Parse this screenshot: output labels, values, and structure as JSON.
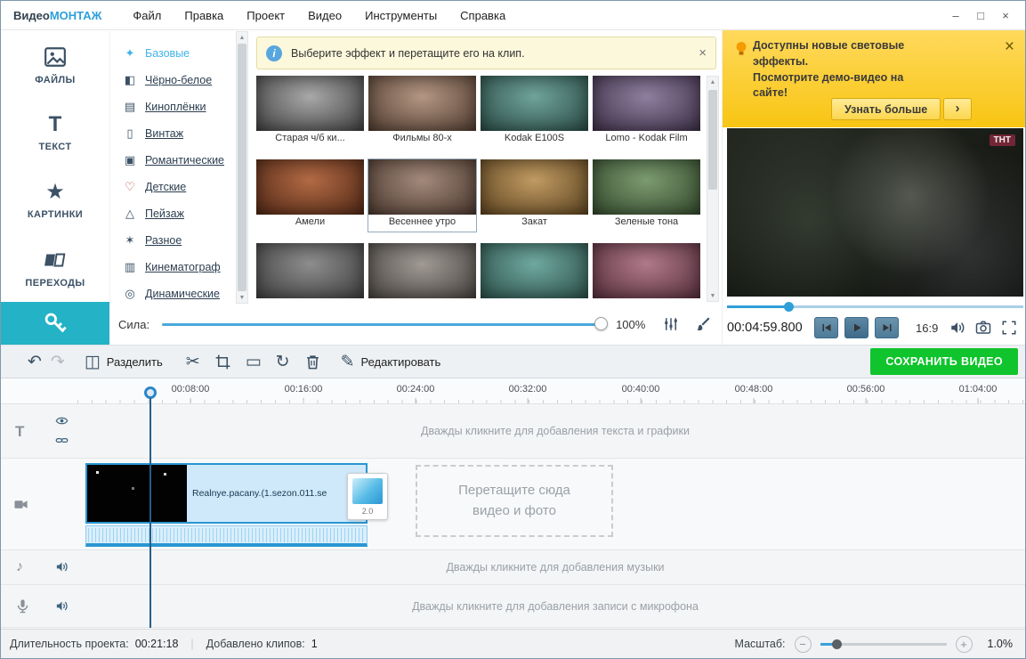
{
  "colors": {
    "accent": "#2f9fd8",
    "teal": "#23b2c6",
    "navy": "#3c5166",
    "green": "#0fc42c",
    "promo_top": "#ffd95c",
    "promo_bottom": "#f8c513",
    "banner_bg": "#fcf8dc",
    "banner_border": "#e4dda2",
    "clip_fill": "#cfe9fa",
    "clip_border": "#2a96d2"
  },
  "icons": {
    "close": "×",
    "minimize": "–",
    "maximize": "□",
    "undo": "↶",
    "redo": "↷",
    "split": "◫",
    "scissors": "✂",
    "letterbox": "▭",
    "rotate": "↻",
    "pencil": "✎",
    "note": "♪",
    "star": "★",
    "text": "T",
    "sparkle": "✦",
    "halftone": "◧",
    "film": "▤",
    "vintage": "▯",
    "romance": "▣",
    "heart": "♡",
    "landscape": "△",
    "misc": "✶",
    "cinema": "▥",
    "dynamic": "◎",
    "arrow_up": "▲",
    "arrow_down": "▼",
    "minus": "−",
    "plus": "+",
    "info": "i",
    "arrow_right": "›"
  },
  "menubar": {
    "app_title": {
      "part1": "Видео",
      "part2": "МОНТАЖ"
    },
    "items": [
      {
        "label": "Файл"
      },
      {
        "label": "Правка"
      },
      {
        "label": "Проект"
      },
      {
        "label": "Видео"
      },
      {
        "label": "Инструменты"
      },
      {
        "label": "Справка"
      }
    ]
  },
  "sidebar": {
    "items": [
      {
        "label": "ФАЙЛЫ",
        "icon": "image-icon"
      },
      {
        "label": "ТЕКСТ",
        "icon": "text-icon"
      },
      {
        "label": "КАРТИНКИ",
        "icon": "star-icon"
      },
      {
        "label": "ПЕРЕХОДЫ",
        "icon": "transitions-icon"
      }
    ],
    "active_tab_icon": "effects-key-icon"
  },
  "categories": {
    "items": [
      {
        "label": "Базовые",
        "icon": "sparkle-icon",
        "active": true
      },
      {
        "label": "Чёрно-белое",
        "icon": "halftone-icon"
      },
      {
        "label": "Киноплёнки",
        "icon": "film-icon"
      },
      {
        "label": "Винтаж",
        "icon": "vintage-icon"
      },
      {
        "label": "Романтические",
        "icon": "romance-icon"
      },
      {
        "label": "Детские",
        "icon": "heart-icon"
      },
      {
        "label": "Пейзаж",
        "icon": "landscape-icon"
      },
      {
        "label": "Разное",
        "icon": "misc-icon"
      },
      {
        "label": "Кинематограф",
        "icon": "cinema-icon"
      },
      {
        "label": "Динамические",
        "icon": "dynamic-icon"
      }
    ]
  },
  "effects_panel": {
    "banner_text": "Выберите эффект и перетащите его на клип.",
    "strength_label": "Сила:",
    "strength_value": "100%",
    "items": [
      {
        "label": "Старая ч/б ки...",
        "tint1": "#a8a8a8",
        "tint2": "#2e2e2e"
      },
      {
        "label": "Фильмы 80-х",
        "tint1": "#b49683",
        "tint2": "#3f2d22"
      },
      {
        "label": "Kodak E100S",
        "tint1": "#6fa39b",
        "tint2": "#1e3b35"
      },
      {
        "label": "Lomo - Kodak Film",
        "tint1": "#8f7f9f",
        "tint2": "#2f2238"
      },
      {
        "label": "Амели",
        "tint1": "#b26a44",
        "tint2": "#3f1c0e"
      },
      {
        "label": "Весеннее утро",
        "tint1": "#a3897b",
        "tint2": "#3a2a20",
        "selected": true
      },
      {
        "label": "Закат",
        "tint1": "#c09a62",
        "tint2": "#4a3414"
      },
      {
        "label": "Зеленые тона",
        "tint1": "#7c9b70",
        "tint2": "#263a20"
      }
    ],
    "partial_row": [
      {
        "tint1": "#8d8d8d",
        "tint2": "#303030"
      },
      {
        "tint1": "#a09a94",
        "tint2": "#36322e"
      },
      {
        "tint1": "#6fa8a0",
        "tint2": "#204039"
      },
      {
        "tint1": "#b07a8a",
        "tint2": "#45202c"
      }
    ]
  },
  "promo": {
    "line1": "Доступны новые световые эффекты.",
    "line2": "Посмотрите демо-видео на сайте!",
    "button_label": "Узнать больше"
  },
  "player": {
    "time": "00:04:59.800",
    "aspect_ratio": "16:9",
    "overlay_logo": "ТНТ"
  },
  "toolbar": {
    "split_label": "Разделить",
    "edit_label": "Редактировать",
    "save_label": "СОХРАНИТЬ ВИДЕО"
  },
  "timeline": {
    "ruler": [
      "00:08:00",
      "00:16:00",
      "00:24:00",
      "00:32:00",
      "00:40:00",
      "00:48:00",
      "00:56:00",
      "01:04:00"
    ],
    "text_track_hint": "Дважды кликните для добавления текста и графики",
    "music_track_hint": "Дважды кликните для добавления музыки",
    "mic_track_hint": "Дважды кликните для добавления записи с микрофона",
    "clip": {
      "name": "Realnye.pacany.(1.sezon.011.se",
      "transition_value": "2.0"
    },
    "dropzone_line1": "Перетащите сюда",
    "dropzone_line2": "видео и фото"
  },
  "statusbar": {
    "duration_label": "Длительность проекта:",
    "duration_value": "00:21:18",
    "clips_label": "Добавлено клипов:",
    "clips_value": "1",
    "zoom_label": "Масштаб:",
    "zoom_value": "1.0%"
  }
}
